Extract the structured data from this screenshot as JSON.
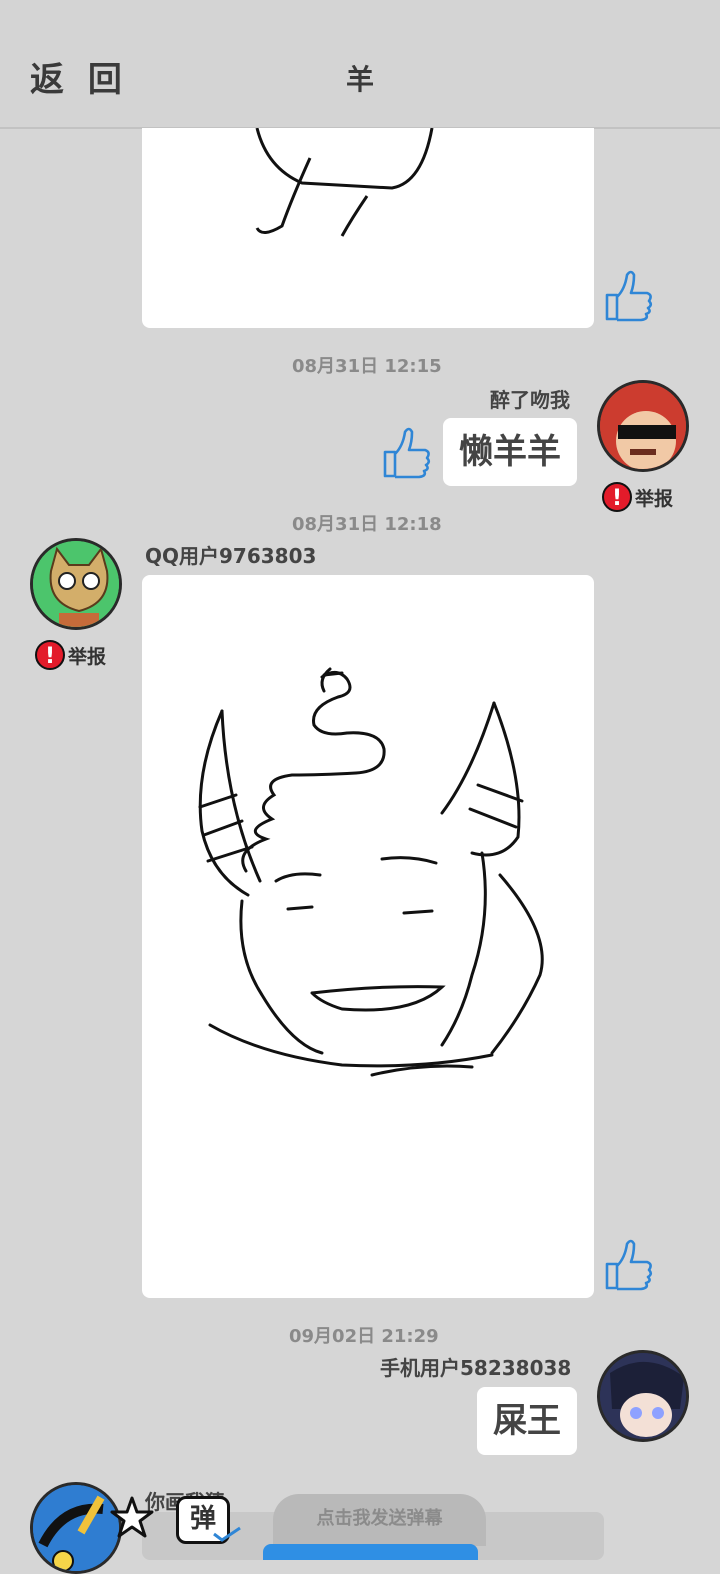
{
  "header": {
    "back_label": "返 回",
    "title": "羊"
  },
  "messages": [
    {
      "timestamp": "08月31日  12:15",
      "username": "醉了吻我",
      "text": "懒羊羊",
      "report_label": "举报"
    },
    {
      "timestamp": "08月31日  12:18",
      "username": "QQ用户9763803",
      "report_label": "举报"
    },
    {
      "timestamp": "09月02日  21:29",
      "username": "手机用户58238038",
      "text": "屎王"
    },
    {
      "username": "你画我猜"
    }
  ],
  "danmaku": {
    "hint": "点击我发送弹幕",
    "toggle_label": "弹"
  },
  "colors": {
    "background": "#d6d6d6",
    "report_red": "#e31b2a",
    "like_blue": "#2f86d6"
  }
}
